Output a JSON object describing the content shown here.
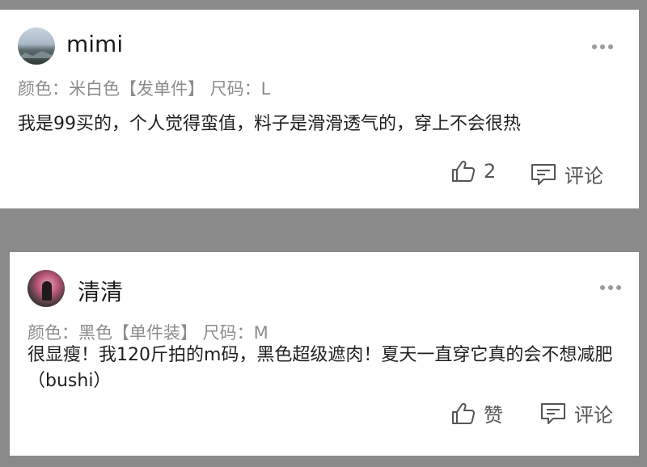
{
  "comments": [
    {
      "username": "mimi",
      "meta": "颜色：米白色【发单件】 尺码：L",
      "content": "我是99买的，个人觉得蛮值，料子是滑滑透气的，穿上不会很热",
      "like_label": "2",
      "comment_label": "评论"
    },
    {
      "username": "清清",
      "meta": "颜色：黑色【单件装】 尺码：M",
      "content": "很显瘦！我120斤拍的m码，黑色超级遮肉！夏天一直穿它真的会不想减肥（bushi）",
      "like_label": "赞",
      "comment_label": "评论"
    }
  ],
  "icons": {
    "more": "more-dots-icon",
    "like": "thumbs-up-icon",
    "comment": "comment-icon"
  },
  "colors": {
    "background": "#8a8a8a",
    "card": "#ffffff",
    "meta_text": "#8c8c8c",
    "body_text": "#1f1f1f"
  }
}
